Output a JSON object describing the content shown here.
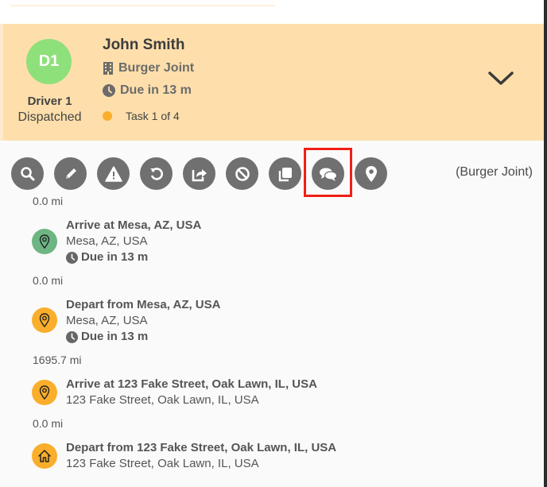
{
  "driver": {
    "initials": "D1",
    "label": "Driver 1",
    "status": "Dispatched",
    "name": "John Smith",
    "business": "Burger Joint",
    "due": "Due in 13 m",
    "task": "Task 1 of 4",
    "avatar_color": "#8ee07a",
    "task_dot_color": "#fbae2b",
    "card_color": "#fedfab"
  },
  "toolbar": {
    "buttons": [
      {
        "name": "search",
        "icon": "search-icon"
      },
      {
        "name": "edit",
        "icon": "pencil-icon"
      },
      {
        "name": "alert",
        "icon": "warning-icon"
      },
      {
        "name": "undo",
        "icon": "undo-icon"
      },
      {
        "name": "share",
        "icon": "share-icon"
      },
      {
        "name": "cancel",
        "icon": "ban-icon"
      },
      {
        "name": "duplicate",
        "icon": "copy-icon"
      },
      {
        "name": "chat",
        "icon": "chat-icon",
        "highlighted": true
      },
      {
        "name": "location",
        "icon": "map-pin-icon"
      }
    ],
    "business_tag": "(Burger Joint)"
  },
  "stops": [
    {
      "distance": "0.0 mi",
      "title": "Arrive at Mesa, AZ, USA",
      "address": "Mesa, AZ, USA",
      "due": "Due in 13 m",
      "icon": "map-pin-icon",
      "icon_color": "#6db582"
    },
    {
      "distance": "0.0 mi",
      "title": "Depart from Mesa, AZ, USA",
      "address": "Mesa, AZ, USA",
      "due": "Due in 13 m",
      "icon": "map-pin-icon",
      "icon_color": "#fbae2b"
    },
    {
      "distance": "1695.7 mi",
      "title": "Arrive at 123 Fake Street, Oak Lawn, IL, USA",
      "address": "123 Fake Street, Oak Lawn, IL, USA",
      "icon": "map-pin-icon",
      "icon_color": "#fbae2b"
    },
    {
      "distance": "0.0 mi",
      "title": "Depart from 123 Fake Street, Oak Lawn, IL, USA",
      "address": "123 Fake Street, Oak Lawn, IL, USA",
      "icon": "home-icon",
      "icon_color": "#fbae2b"
    }
  ]
}
